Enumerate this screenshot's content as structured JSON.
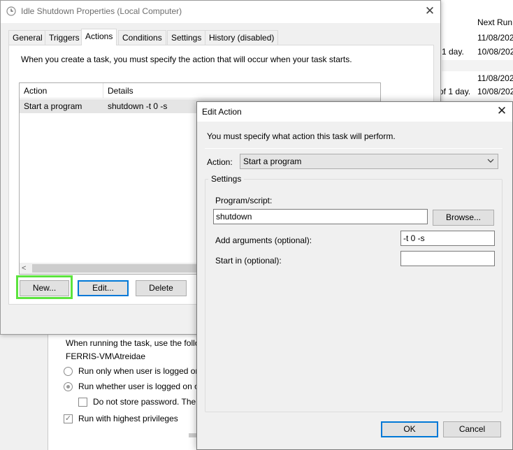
{
  "background_window": {
    "column_header": "Next Run",
    "rows": [
      {
        "trigger_fragment": "",
        "next_run": "11/08/202"
      },
      {
        "trigger_fragment": "1 day.",
        "next_run": "10/08/202"
      },
      {
        "trigger_fragment": "",
        "next_run": "11/08/202"
      },
      {
        "trigger_fragment": "of 1 day.",
        "next_run": "10/08/202"
      }
    ],
    "security": {
      "run_as_text": "When running the task, use the follo",
      "account": "FERRIS-VM\\Atreidae",
      "option_logged_on": "Run only when user is logged or",
      "option_whether": "Run whether user is logged on o",
      "do_not_store": "Do not store password.  The",
      "highest_privileges": "Run with highest privileges"
    }
  },
  "properties_dialog": {
    "title": "Idle Shutdown Properties (Local Computer)",
    "close_glyph": "✕",
    "tabs": [
      {
        "label": "General"
      },
      {
        "label": "Triggers"
      },
      {
        "label": "Actions"
      },
      {
        "label": "Conditions"
      },
      {
        "label": "Settings"
      },
      {
        "label": "History (disabled)"
      }
    ],
    "active_tab": "Actions",
    "description": "When you create a task, you must specify the action that will occur when your task starts.",
    "list": {
      "columns": [
        "Action",
        "Details"
      ],
      "rows": [
        {
          "action": "Start a program",
          "details": "shutdown -t 0 -s"
        }
      ],
      "scroll_left_glyph": "<"
    },
    "buttons": {
      "new": "New...",
      "edit": "Edit...",
      "delete": "Delete"
    },
    "highlight_color": "#5ce33e"
  },
  "edit_action_dialog": {
    "title": "Edit Action",
    "close_glyph": "✕",
    "description": "You must specify what action this task will perform.",
    "action_label": "Action:",
    "action_value": "Start a program",
    "settings_label": "Settings",
    "program_label": "Program/script:",
    "program_value": "shutdown",
    "browse_button": "Browse...",
    "arguments_label": "Add arguments (optional):",
    "arguments_value": "-t 0 -s",
    "start_in_label": "Start in (optional):",
    "start_in_value": "",
    "ok_button": "OK",
    "cancel_button": "Cancel",
    "accent_color": "#0078d7"
  }
}
